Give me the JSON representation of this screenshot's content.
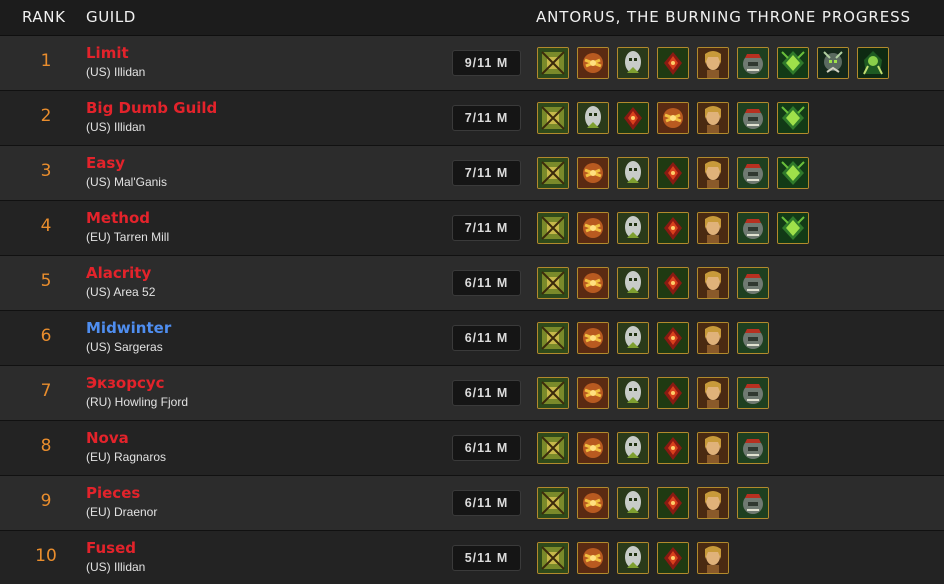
{
  "header": {
    "rank": "RANK",
    "guild": "GUILD",
    "progress": "ANTORUS, THE BURNING THRONE PROGRESS"
  },
  "colors": {
    "rank": "#e98d2d",
    "horde": "#e3232b",
    "alliance": "#4f8ef0",
    "icon_border": "#b28a2c"
  },
  "bosses": [
    "garothi-worldbreaker-icon",
    "felhounds-of-sargeras-icon",
    "antoran-high-command-icon",
    "portal-keeper-hasabel-icon",
    "eonar-the-lifebinder-icon",
    "imonar-the-soulhunter-icon",
    "kingaroth-icon",
    "varimathras-icon",
    "coven-of-shivarra-icon",
    "aggramar-icon"
  ],
  "guilds": [
    {
      "rank": "1",
      "name": "Limit",
      "realm": "(US) Illidan",
      "progress": "9/11 M",
      "color": "#e3232b",
      "icons": [
        0,
        1,
        2,
        3,
        4,
        5,
        6,
        7,
        8
      ]
    },
    {
      "rank": "2",
      "name": "Big Dumb Guild",
      "realm": "(US) Illidan",
      "progress": "7/11 M",
      "color": "#e3232b",
      "icons": [
        0,
        2,
        3,
        1,
        4,
        5,
        6
      ]
    },
    {
      "rank": "3",
      "name": "Easy",
      "realm": "(US) Mal'Ganis",
      "progress": "7/11 M",
      "color": "#e3232b",
      "icons": [
        0,
        1,
        2,
        3,
        4,
        5,
        6
      ]
    },
    {
      "rank": "4",
      "name": "Method",
      "realm": "(EU) Tarren Mill",
      "progress": "7/11 M",
      "color": "#e3232b",
      "icons": [
        0,
        1,
        2,
        3,
        4,
        5,
        6
      ]
    },
    {
      "rank": "5",
      "name": "Alacrity",
      "realm": "(US) Area 52",
      "progress": "6/11 M",
      "color": "#e3232b",
      "icons": [
        0,
        1,
        2,
        3,
        4,
        5
      ]
    },
    {
      "rank": "6",
      "name": "Midwinter",
      "realm": "(US) Sargeras",
      "progress": "6/11 M",
      "color": "#4f8ef0",
      "icons": [
        0,
        1,
        2,
        3,
        4,
        5
      ]
    },
    {
      "rank": "7",
      "name": "Экзорсус",
      "realm": "(RU) Howling Fjord",
      "progress": "6/11 M",
      "color": "#e3232b",
      "icons": [
        0,
        1,
        2,
        3,
        4,
        5
      ]
    },
    {
      "rank": "8",
      "name": "Nova",
      "realm": "(EU) Ragnaros",
      "progress": "6/11 M",
      "color": "#e3232b",
      "icons": [
        0,
        1,
        2,
        3,
        4,
        5
      ]
    },
    {
      "rank": "9",
      "name": "Pieces",
      "realm": "(EU) Draenor",
      "progress": "6/11 M",
      "color": "#e3232b",
      "icons": [
        0,
        1,
        2,
        3,
        4,
        5
      ]
    },
    {
      "rank": "10",
      "name": "Fused",
      "realm": "(US) Illidan",
      "progress": "5/11 M",
      "color": "#e3232b",
      "icons": [
        0,
        1,
        2,
        3,
        4
      ]
    }
  ]
}
